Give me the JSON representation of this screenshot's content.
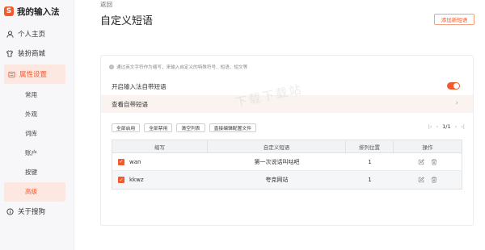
{
  "app": {
    "logo_char": "S",
    "title": "我的输入法"
  },
  "sidebar": {
    "items": [
      {
        "label": "个人主页",
        "icon": "user-icon"
      },
      {
        "label": "装扮商城",
        "icon": "shirt-icon"
      },
      {
        "label": "属性设置",
        "icon": "settings-icon",
        "active": true
      }
    ],
    "sub_items": [
      {
        "label": "常用"
      },
      {
        "label": "外观"
      },
      {
        "label": "词库"
      },
      {
        "label": "账户"
      },
      {
        "label": "按键"
      },
      {
        "label": "高级",
        "active": true
      }
    ],
    "about": {
      "label": "关于搜狗",
      "icon": "info-icon"
    }
  },
  "header": {
    "back_label": "返回",
    "title": "自定义短语",
    "add_button": "添加新短语"
  },
  "panel": {
    "info_text": "通过英文字符作为缩写，来输入自定义的特殊符号、短语、短文等",
    "enable_label": "开启输入法自带短语",
    "enable_toggle": true,
    "view_label": "查看自带短语",
    "toolbar": {
      "enable_all": "全部启用",
      "disable_all": "全部禁用",
      "clear_list": "清空列表",
      "edit_config": "直接编辑配置文件"
    },
    "pager": {
      "first": "|‹",
      "prev": "‹",
      "page": "1/1",
      "next": "›",
      "last": "›|"
    },
    "table": {
      "headers": [
        "缩写",
        "自定义短语",
        "排列位置",
        "操作"
      ],
      "rows": [
        {
          "abbr": "wan",
          "phrase": "第一次说话叫咕吧",
          "position": "1",
          "checked": true
        },
        {
          "abbr": "kkwz",
          "phrase": "夸克网站",
          "position": "1",
          "checked": true
        }
      ]
    }
  },
  "watermark": "下载下载站",
  "colors": {
    "accent": "#f25a2e",
    "accent_light": "#fde8e1",
    "sidebar_bg": "#f7f7f9"
  }
}
